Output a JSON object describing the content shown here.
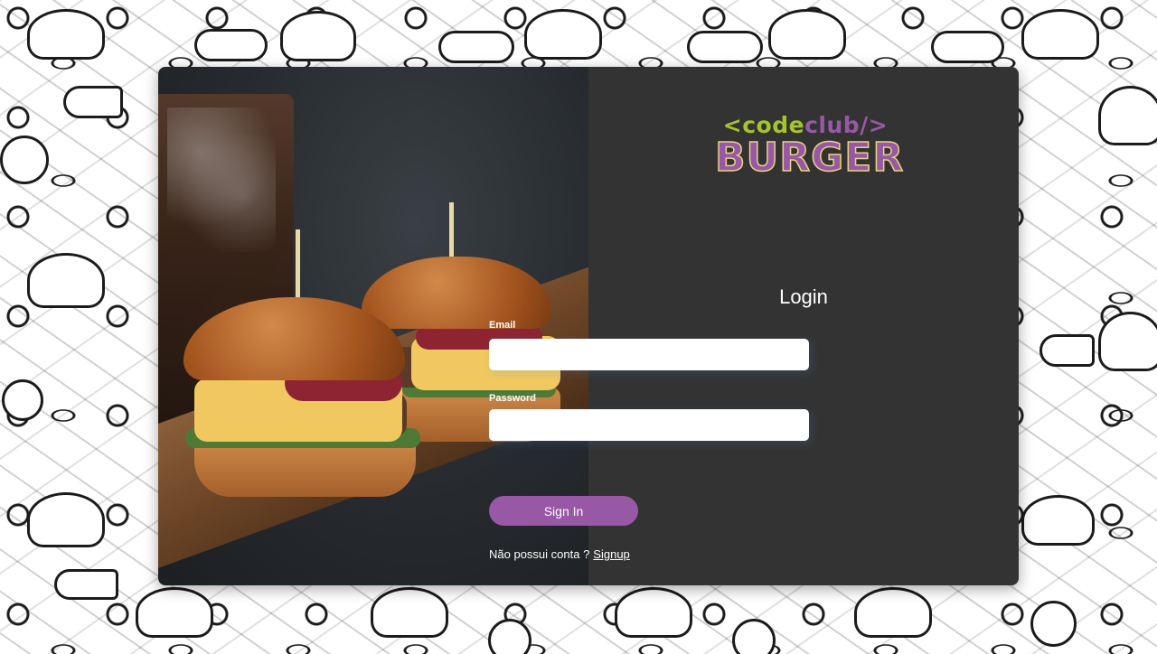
{
  "logo": {
    "code_prefix": "<code",
    "code_suffix": "club/>",
    "brand": "BURGER"
  },
  "login": {
    "title": "Login",
    "email_label": "Email",
    "email_value": "",
    "password_label": "Password",
    "password_value": "",
    "submit_label": "Sign In",
    "no_account_text": "Não possui conta ?",
    "signup_link": "Signup"
  },
  "colors": {
    "panel_bg": "#333333",
    "accent_purple": "#9758a6",
    "accent_lime": "#a5c32e",
    "input_bg": "#ffffff"
  }
}
